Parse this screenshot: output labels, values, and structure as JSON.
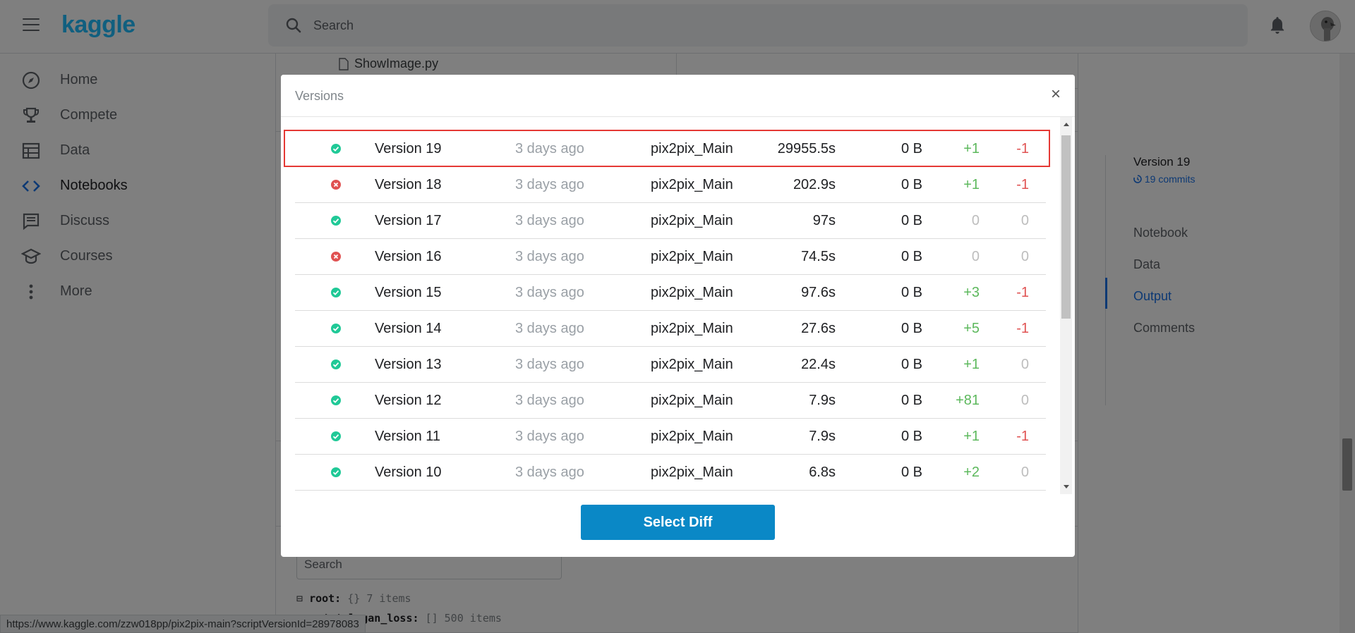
{
  "header": {
    "logo": "kaggle",
    "search_placeholder": "Search",
    "icons": [
      "menu-icon",
      "search-icon",
      "bell-icon",
      "avatar"
    ]
  },
  "sidebar": {
    "items": [
      {
        "label": "Home",
        "icon": "compass-icon"
      },
      {
        "label": "Compete",
        "icon": "trophy-icon"
      },
      {
        "label": "Data",
        "icon": "table-icon"
      },
      {
        "label": "Notebooks",
        "icon": "code-icon",
        "active": true
      },
      {
        "label": "Discuss",
        "icon": "comment-icon"
      },
      {
        "label": "Courses",
        "icon": "school-icon"
      },
      {
        "label": "More",
        "icon": "more-vert-icon"
      }
    ]
  },
  "background": {
    "file_name": "ShowImage.py",
    "search_placeholder": "Search",
    "json_root_key": "root:",
    "json_root_meta": "{} 7 items",
    "json_child_key": "total_gan_loss:",
    "json_child_meta": "[] 500 items",
    "status_url": "https://www.kaggle.com/zzw018pp/pix2pix-main?scriptVersionId=28978083"
  },
  "right_panel": {
    "version_title": "Version 19",
    "commits": "19 commits",
    "links": [
      "Notebook",
      "Data",
      "Output",
      "Comments"
    ],
    "active_link": "Output"
  },
  "modal": {
    "title": "Versions",
    "close_label": "×",
    "button_label": "Select Diff",
    "versions": [
      {
        "status": "success",
        "version": "Version 19",
        "date": "3 days ago",
        "kernel": "pix2pix_Main",
        "runtime": "29955.5s",
        "size": "0 B",
        "added": "+1",
        "removed": "-1"
      },
      {
        "status": "error",
        "version": "Version 18",
        "date": "3 days ago",
        "kernel": "pix2pix_Main",
        "runtime": "202.9s",
        "size": "0 B",
        "added": "+1",
        "removed": "-1"
      },
      {
        "status": "success",
        "version": "Version 17",
        "date": "3 days ago",
        "kernel": "pix2pix_Main",
        "runtime": "97s",
        "size": "0 B",
        "added": "0",
        "removed": "0"
      },
      {
        "status": "error",
        "version": "Version 16",
        "date": "3 days ago",
        "kernel": "pix2pix_Main",
        "runtime": "74.5s",
        "size": "0 B",
        "added": "0",
        "removed": "0"
      },
      {
        "status": "success",
        "version": "Version 15",
        "date": "3 days ago",
        "kernel": "pix2pix_Main",
        "runtime": "97.6s",
        "size": "0 B",
        "added": "+3",
        "removed": "-1"
      },
      {
        "status": "success",
        "version": "Version 14",
        "date": "3 days ago",
        "kernel": "pix2pix_Main",
        "runtime": "27.6s",
        "size": "0 B",
        "added": "+5",
        "removed": "-1"
      },
      {
        "status": "success",
        "version": "Version 13",
        "date": "3 days ago",
        "kernel": "pix2pix_Main",
        "runtime": "22.4s",
        "size": "0 B",
        "added": "+1",
        "removed": "0"
      },
      {
        "status": "success",
        "version": "Version 12",
        "date": "3 days ago",
        "kernel": "pix2pix_Main",
        "runtime": "7.9s",
        "size": "0 B",
        "added": "+81",
        "removed": "0"
      },
      {
        "status": "success",
        "version": "Version 11",
        "date": "3 days ago",
        "kernel": "pix2pix_Main",
        "runtime": "7.9s",
        "size": "0 B",
        "added": "+1",
        "removed": "-1"
      },
      {
        "status": "success",
        "version": "Version 10",
        "date": "3 days ago",
        "kernel": "pix2pix_Main",
        "runtime": "6.8s",
        "size": "0 B",
        "added": "+2",
        "removed": "0"
      }
    ],
    "selected_version": "Version 19"
  },
  "colors": {
    "accent": "#20beff",
    "button": "#0a88c6",
    "success": "#20c997",
    "error": "#e05252",
    "positive": "#5cb85c",
    "negative": "#e05252",
    "highlight": "#e53935"
  }
}
